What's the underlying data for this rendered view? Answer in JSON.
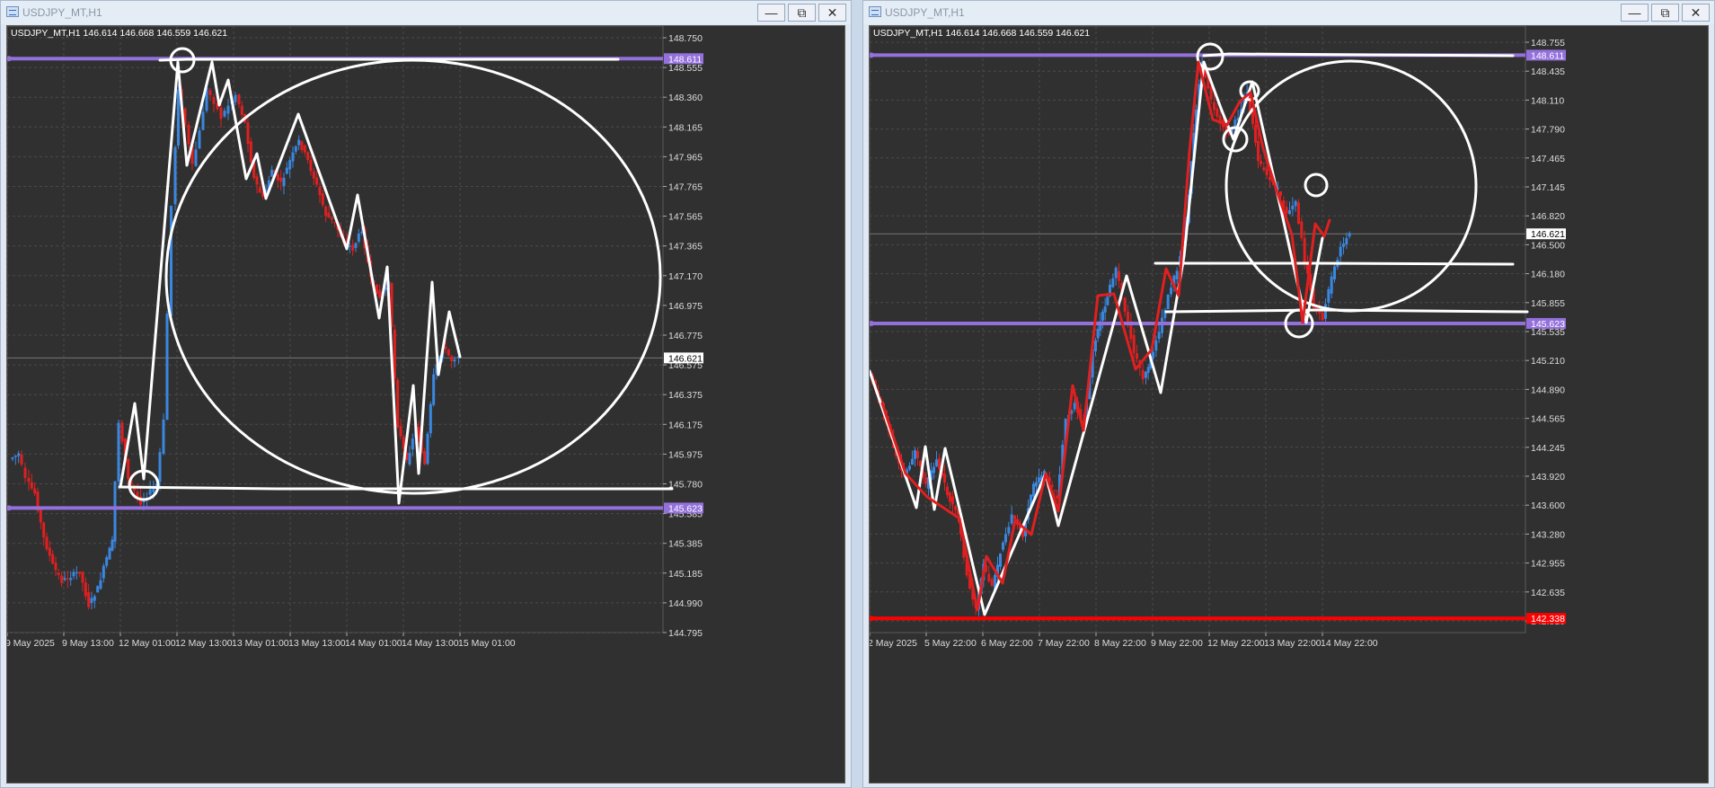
{
  "colors": {
    "background": "#303030",
    "grid": "#4a4a4a",
    "bull": "#3a87e0",
    "bear": "#e02020",
    "level_line": "#9370db",
    "red_level": "#ff0000",
    "drawing": "#ffffff",
    "price_label_bg": "#ffffff"
  },
  "left_window": {
    "title": "USDJPY_MT,H1",
    "info": "USDJPY_MT,H1  146.614 146.668 146.559 146.621",
    "buttons": {
      "minimize": "—",
      "maximize": "⧉",
      "close": "✕"
    },
    "price_axis": [
      "148.750",
      "148.555",
      "148.360",
      "148.165",
      "147.965",
      "147.765",
      "147.565",
      "147.365",
      "147.170",
      "146.975",
      "146.775",
      "146.575",
      "146.375",
      "146.175",
      "145.975",
      "145.780",
      "145.585",
      "145.385",
      "145.185",
      "144.990",
      "144.795"
    ],
    "time_axis": [
      "9 May 2025",
      "9 May 13:00",
      "12 May 01:00",
      "12 May 13:00",
      "13 May 01:00",
      "13 May 13:00",
      "14 May 01:00",
      "14 May 13:00",
      "15 May 01:00"
    ],
    "current_price": "146.621",
    "levels": [
      {
        "price": 148.611,
        "label": "148.611",
        "color": "#9370db"
      },
      {
        "price": 145.623,
        "label": "145.623",
        "color": "#9370db"
      }
    ]
  },
  "right_window": {
    "title": "USDJPY_MT,H1",
    "info": "USDJPY_MT,H1  146.614 146.668 146.559 146.621",
    "buttons": {
      "minimize": "—",
      "maximize": "⧉",
      "close": "✕"
    },
    "price_axis": [
      "148.755",
      "148.435",
      "148.110",
      "147.790",
      "147.465",
      "147.145",
      "146.820",
      "146.500",
      "146.180",
      "145.855",
      "145.535",
      "145.210",
      "144.890",
      "144.565",
      "144.245",
      "143.920",
      "143.600",
      "143.280",
      "142.955",
      "142.635",
      "142.310"
    ],
    "time_axis": [
      "2 May 2025",
      "5 May 22:00",
      "6 May 22:00",
      "7 May 22:00",
      "8 May 22:00",
      "9 May 22:00",
      "12 May 22:00",
      "13 May 22:00",
      "14 May 22:00"
    ],
    "current_price": "146.621",
    "levels": [
      {
        "price": 148.611,
        "label": "148.611",
        "color": "#9370db"
      },
      {
        "price": 145.623,
        "label": "145.623",
        "color": "#9370db"
      },
      {
        "price": 142.338,
        "label": "142.338",
        "color": "#ff0000"
      }
    ]
  }
}
